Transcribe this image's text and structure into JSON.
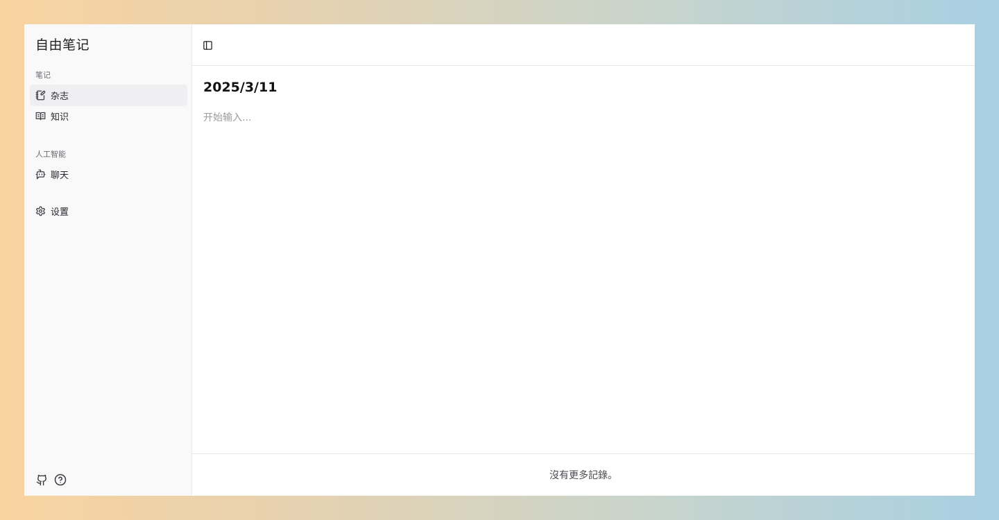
{
  "app": {
    "title": "自由笔记"
  },
  "sidebar": {
    "sections": [
      {
        "label": "笔记",
        "items": [
          {
            "label": "杂志",
            "icon": "notebook-pen-icon",
            "active": true
          },
          {
            "label": "知识",
            "icon": "book-open-icon",
            "active": false
          }
        ]
      },
      {
        "label": "人工智能",
        "items": [
          {
            "label": "聊天",
            "icon": "bot-chat-icon",
            "active": false
          }
        ]
      }
    ],
    "settings": {
      "label": "设置",
      "icon": "gear-icon"
    },
    "footer": {
      "github_icon": "github-icon",
      "help_icon": "help-circle-icon"
    }
  },
  "main": {
    "toggle_icon": "panel-left-icon",
    "entry": {
      "date": "2025/3/11",
      "placeholder": "开始输入..."
    },
    "status": "沒有更多記錄。"
  },
  "colors": {
    "sidebar_bg": "#f9f9fa",
    "active_item_bg": "#efeff1",
    "border": "#e7e7ea",
    "placeholder_text": "#9a9aa0"
  }
}
